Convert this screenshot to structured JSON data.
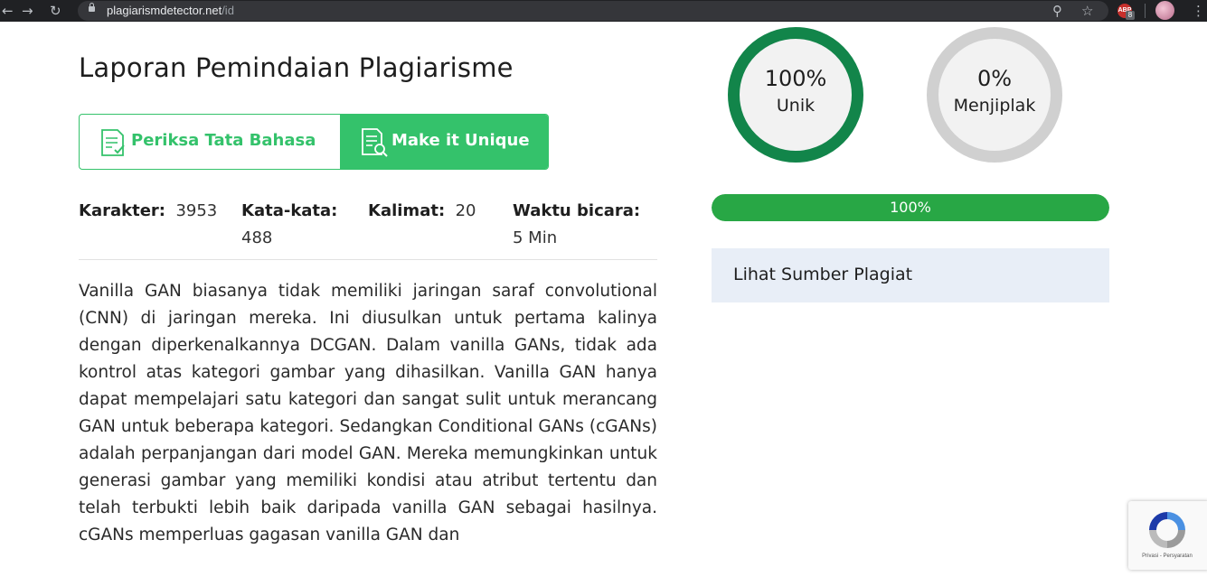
{
  "browser": {
    "url_host": "plagiarismdetector.net",
    "url_path": "/id",
    "extension_badge_text": "ABP",
    "extension_badge_count": "8"
  },
  "report": {
    "title": "Laporan Pemindaian Plagiarisme",
    "grammar_button": "Periksa Tata Bahasa",
    "unique_button": "Make it Unique",
    "stats": {
      "characters_label": "Karakter:",
      "characters_value": "3953",
      "words_label": "Kata-kata:",
      "words_value": "488",
      "sentences_label": "Kalimat:",
      "sentences_value": "20",
      "speaking_label": "Waktu bicara:",
      "speaking_value": "5 Min"
    },
    "text": "Vanilla GAN biasanya tidak memiliki jaringan saraf convolutional (CNN) di jaringan mereka. Ini diusulkan untuk pertama kalinya dengan diperkenalkannya DCGAN. Dalam vanilla GANs, tidak ada kontrol atas kategori gambar yang dihasilkan. Vanilla GAN hanya dapat mempelajari satu kategori dan sangat sulit untuk merancang GAN untuk beberapa kategori. Sedangkan Conditional GANs (cGANs) adalah perpanjangan dari model GAN. Mereka memungkinkan untuk generasi gambar yang memiliki kondisi atau atribut tertentu dan telah terbukti lebih baik daripada vanilla GAN sebagai hasilnya. cGANs memperluas gagasan vanilla GAN dan"
  },
  "results": {
    "unique_percent": "100%",
    "unique_label": "Unik",
    "plagiarized_percent": "0%",
    "plagiarized_label": "Menjiplak",
    "progress_value": 100,
    "progress_label": "100%",
    "sources_label": "Lihat Sumber Plagiat"
  },
  "recaptcha": {
    "terms": "Privasi - Persyaratan"
  },
  "colors": {
    "accent_green": "#34c26b",
    "unique_ring": "#12854a",
    "plag_ring": "#d0d0d0",
    "progress_green": "#28a745",
    "source_bg": "#e8eef7"
  }
}
